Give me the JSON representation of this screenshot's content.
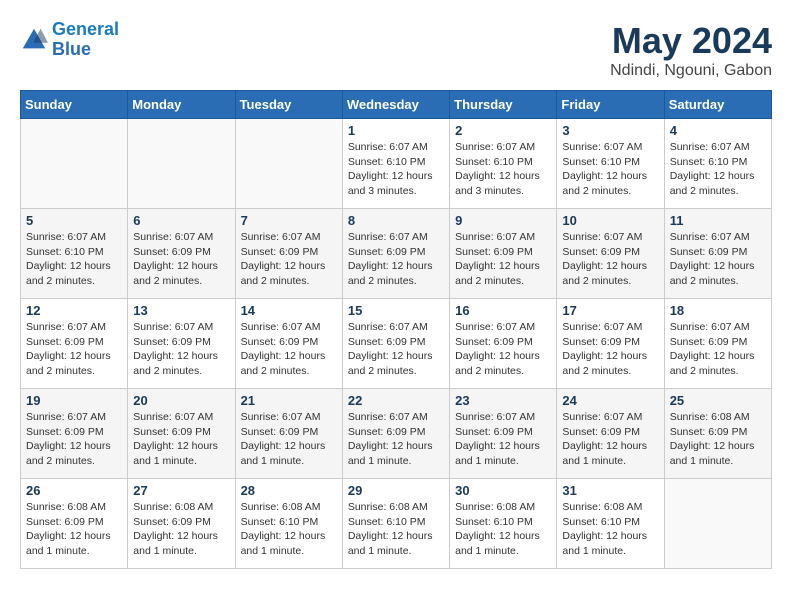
{
  "header": {
    "logo_line1": "General",
    "logo_line2": "Blue",
    "month": "May 2024",
    "location": "Ndindi, Ngouni, Gabon"
  },
  "weekdays": [
    "Sunday",
    "Monday",
    "Tuesday",
    "Wednesday",
    "Thursday",
    "Friday",
    "Saturday"
  ],
  "weeks": [
    [
      {
        "day": "",
        "info": ""
      },
      {
        "day": "",
        "info": ""
      },
      {
        "day": "",
        "info": ""
      },
      {
        "day": "1",
        "info": "Sunrise: 6:07 AM\nSunset: 6:10 PM\nDaylight: 12 hours\nand 3 minutes."
      },
      {
        "day": "2",
        "info": "Sunrise: 6:07 AM\nSunset: 6:10 PM\nDaylight: 12 hours\nand 3 minutes."
      },
      {
        "day": "3",
        "info": "Sunrise: 6:07 AM\nSunset: 6:10 PM\nDaylight: 12 hours\nand 2 minutes."
      },
      {
        "day": "4",
        "info": "Sunrise: 6:07 AM\nSunset: 6:10 PM\nDaylight: 12 hours\nand 2 minutes."
      }
    ],
    [
      {
        "day": "5",
        "info": "Sunrise: 6:07 AM\nSunset: 6:10 PM\nDaylight: 12 hours\nand 2 minutes."
      },
      {
        "day": "6",
        "info": "Sunrise: 6:07 AM\nSunset: 6:09 PM\nDaylight: 12 hours\nand 2 minutes."
      },
      {
        "day": "7",
        "info": "Sunrise: 6:07 AM\nSunset: 6:09 PM\nDaylight: 12 hours\nand 2 minutes."
      },
      {
        "day": "8",
        "info": "Sunrise: 6:07 AM\nSunset: 6:09 PM\nDaylight: 12 hours\nand 2 minutes."
      },
      {
        "day": "9",
        "info": "Sunrise: 6:07 AM\nSunset: 6:09 PM\nDaylight: 12 hours\nand 2 minutes."
      },
      {
        "day": "10",
        "info": "Sunrise: 6:07 AM\nSunset: 6:09 PM\nDaylight: 12 hours\nand 2 minutes."
      },
      {
        "day": "11",
        "info": "Sunrise: 6:07 AM\nSunset: 6:09 PM\nDaylight: 12 hours\nand 2 minutes."
      }
    ],
    [
      {
        "day": "12",
        "info": "Sunrise: 6:07 AM\nSunset: 6:09 PM\nDaylight: 12 hours\nand 2 minutes."
      },
      {
        "day": "13",
        "info": "Sunrise: 6:07 AM\nSunset: 6:09 PM\nDaylight: 12 hours\nand 2 minutes."
      },
      {
        "day": "14",
        "info": "Sunrise: 6:07 AM\nSunset: 6:09 PM\nDaylight: 12 hours\nand 2 minutes."
      },
      {
        "day": "15",
        "info": "Sunrise: 6:07 AM\nSunset: 6:09 PM\nDaylight: 12 hours\nand 2 minutes."
      },
      {
        "day": "16",
        "info": "Sunrise: 6:07 AM\nSunset: 6:09 PM\nDaylight: 12 hours\nand 2 minutes."
      },
      {
        "day": "17",
        "info": "Sunrise: 6:07 AM\nSunset: 6:09 PM\nDaylight: 12 hours\nand 2 minutes."
      },
      {
        "day": "18",
        "info": "Sunrise: 6:07 AM\nSunset: 6:09 PM\nDaylight: 12 hours\nand 2 minutes."
      }
    ],
    [
      {
        "day": "19",
        "info": "Sunrise: 6:07 AM\nSunset: 6:09 PM\nDaylight: 12 hours\nand 2 minutes."
      },
      {
        "day": "20",
        "info": "Sunrise: 6:07 AM\nSunset: 6:09 PM\nDaylight: 12 hours\nand 1 minute."
      },
      {
        "day": "21",
        "info": "Sunrise: 6:07 AM\nSunset: 6:09 PM\nDaylight: 12 hours\nand 1 minute."
      },
      {
        "day": "22",
        "info": "Sunrise: 6:07 AM\nSunset: 6:09 PM\nDaylight: 12 hours\nand 1 minute."
      },
      {
        "day": "23",
        "info": "Sunrise: 6:07 AM\nSunset: 6:09 PM\nDaylight: 12 hours\nand 1 minute."
      },
      {
        "day": "24",
        "info": "Sunrise: 6:07 AM\nSunset: 6:09 PM\nDaylight: 12 hours\nand 1 minute."
      },
      {
        "day": "25",
        "info": "Sunrise: 6:08 AM\nSunset: 6:09 PM\nDaylight: 12 hours\nand 1 minute."
      }
    ],
    [
      {
        "day": "26",
        "info": "Sunrise: 6:08 AM\nSunset: 6:09 PM\nDaylight: 12 hours\nand 1 minute."
      },
      {
        "day": "27",
        "info": "Sunrise: 6:08 AM\nSunset: 6:09 PM\nDaylight: 12 hours\nand 1 minute."
      },
      {
        "day": "28",
        "info": "Sunrise: 6:08 AM\nSunset: 6:10 PM\nDaylight: 12 hours\nand 1 minute."
      },
      {
        "day": "29",
        "info": "Sunrise: 6:08 AM\nSunset: 6:10 PM\nDaylight: 12 hours\nand 1 minute."
      },
      {
        "day": "30",
        "info": "Sunrise: 6:08 AM\nSunset: 6:10 PM\nDaylight: 12 hours\nand 1 minute."
      },
      {
        "day": "31",
        "info": "Sunrise: 6:08 AM\nSunset: 6:10 PM\nDaylight: 12 hours\nand 1 minute."
      },
      {
        "day": "",
        "info": ""
      }
    ]
  ]
}
